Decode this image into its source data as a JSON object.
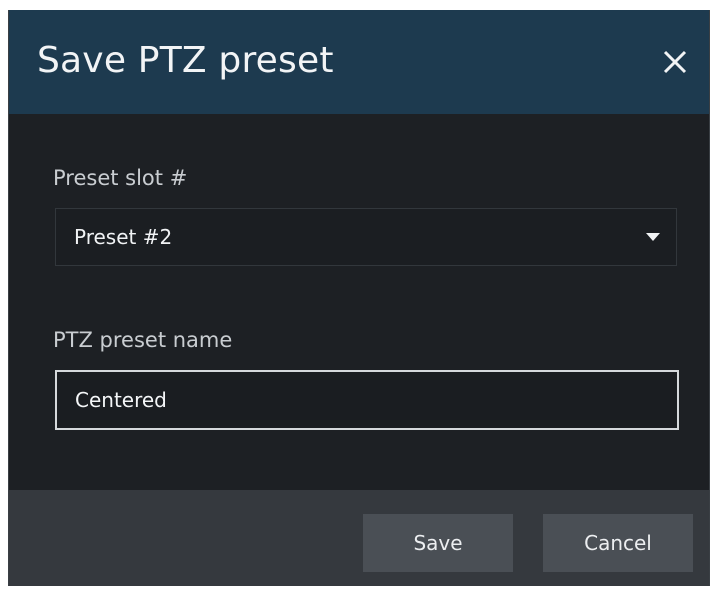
{
  "dialog": {
    "title": "Save PTZ preset",
    "close_icon": "close-icon"
  },
  "preset_slot": {
    "label": "Preset slot #",
    "selected": "Preset #2",
    "dropdown_icon": "chevron-down-icon"
  },
  "preset_name": {
    "label": "PTZ preset name",
    "value": "Centered"
  },
  "footer": {
    "save_label": "Save",
    "cancel_label": "Cancel"
  },
  "colors": {
    "titlebar": "#1d3a4f",
    "body": "#1d2024",
    "footer": "#35393e",
    "button": "#4a4f55"
  }
}
